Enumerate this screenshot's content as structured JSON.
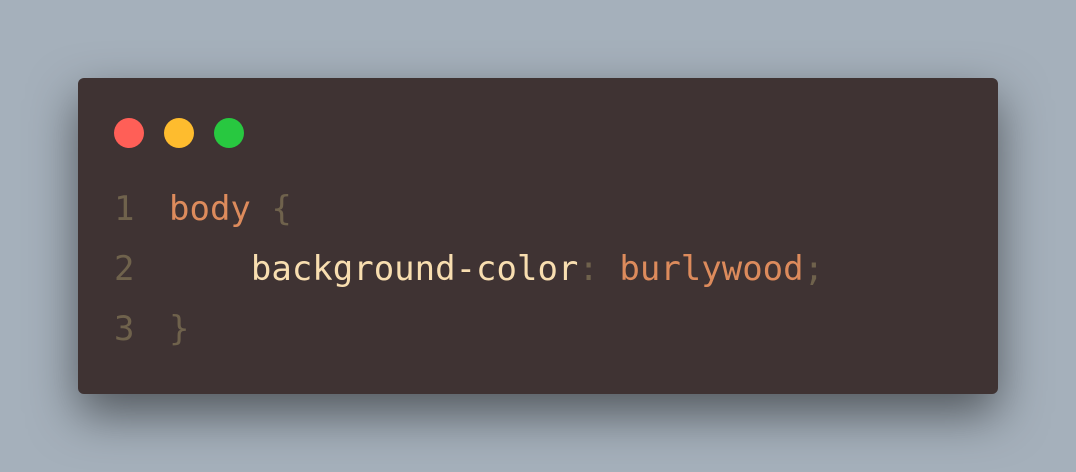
{
  "window_controls": {
    "close": {
      "color": "#ff5f57"
    },
    "minimize": {
      "color": "#febc2e"
    },
    "maximize": {
      "color": "#28c840"
    }
  },
  "code": {
    "lines": [
      {
        "number": "1",
        "selector": "body",
        "open_brace": "{"
      },
      {
        "number": "2",
        "indent": "    ",
        "property": "background-color",
        "colon": ":",
        "value": "burlywood",
        "semicolon": ";"
      },
      {
        "number": "3",
        "close_brace": "}"
      }
    ]
  },
  "colors": {
    "page_background": "#a5b0bb",
    "window_background": "#3f3333",
    "line_number": "#6f624c",
    "selector": "#dd8b5c",
    "property": "#f8deb0",
    "value": "#dd8b5c"
  }
}
